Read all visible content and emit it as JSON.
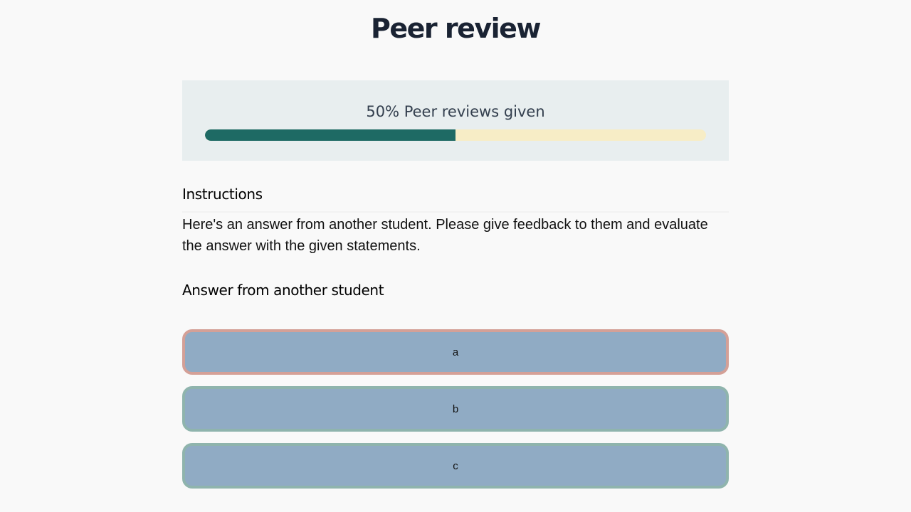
{
  "header": {
    "title": "Peer review"
  },
  "progress": {
    "label": "50% Peer reviews given",
    "fraction": 0.5,
    "fill_color": "#1e6a64",
    "track_color": "#f7edc6"
  },
  "instructions": {
    "heading": "Instructions",
    "text": "Here's an answer from another student. Please give feedback to them and evaluate the answer with the given statements."
  },
  "answer": {
    "heading": "Answer from another student",
    "options": [
      {
        "label": "a",
        "selected": true
      },
      {
        "label": "b",
        "selected": false
      },
      {
        "label": "c",
        "selected": false
      }
    ],
    "selected_border_color": "#d4a097",
    "default_border_color": "#8fb4ad",
    "option_background": "#90abc4"
  }
}
